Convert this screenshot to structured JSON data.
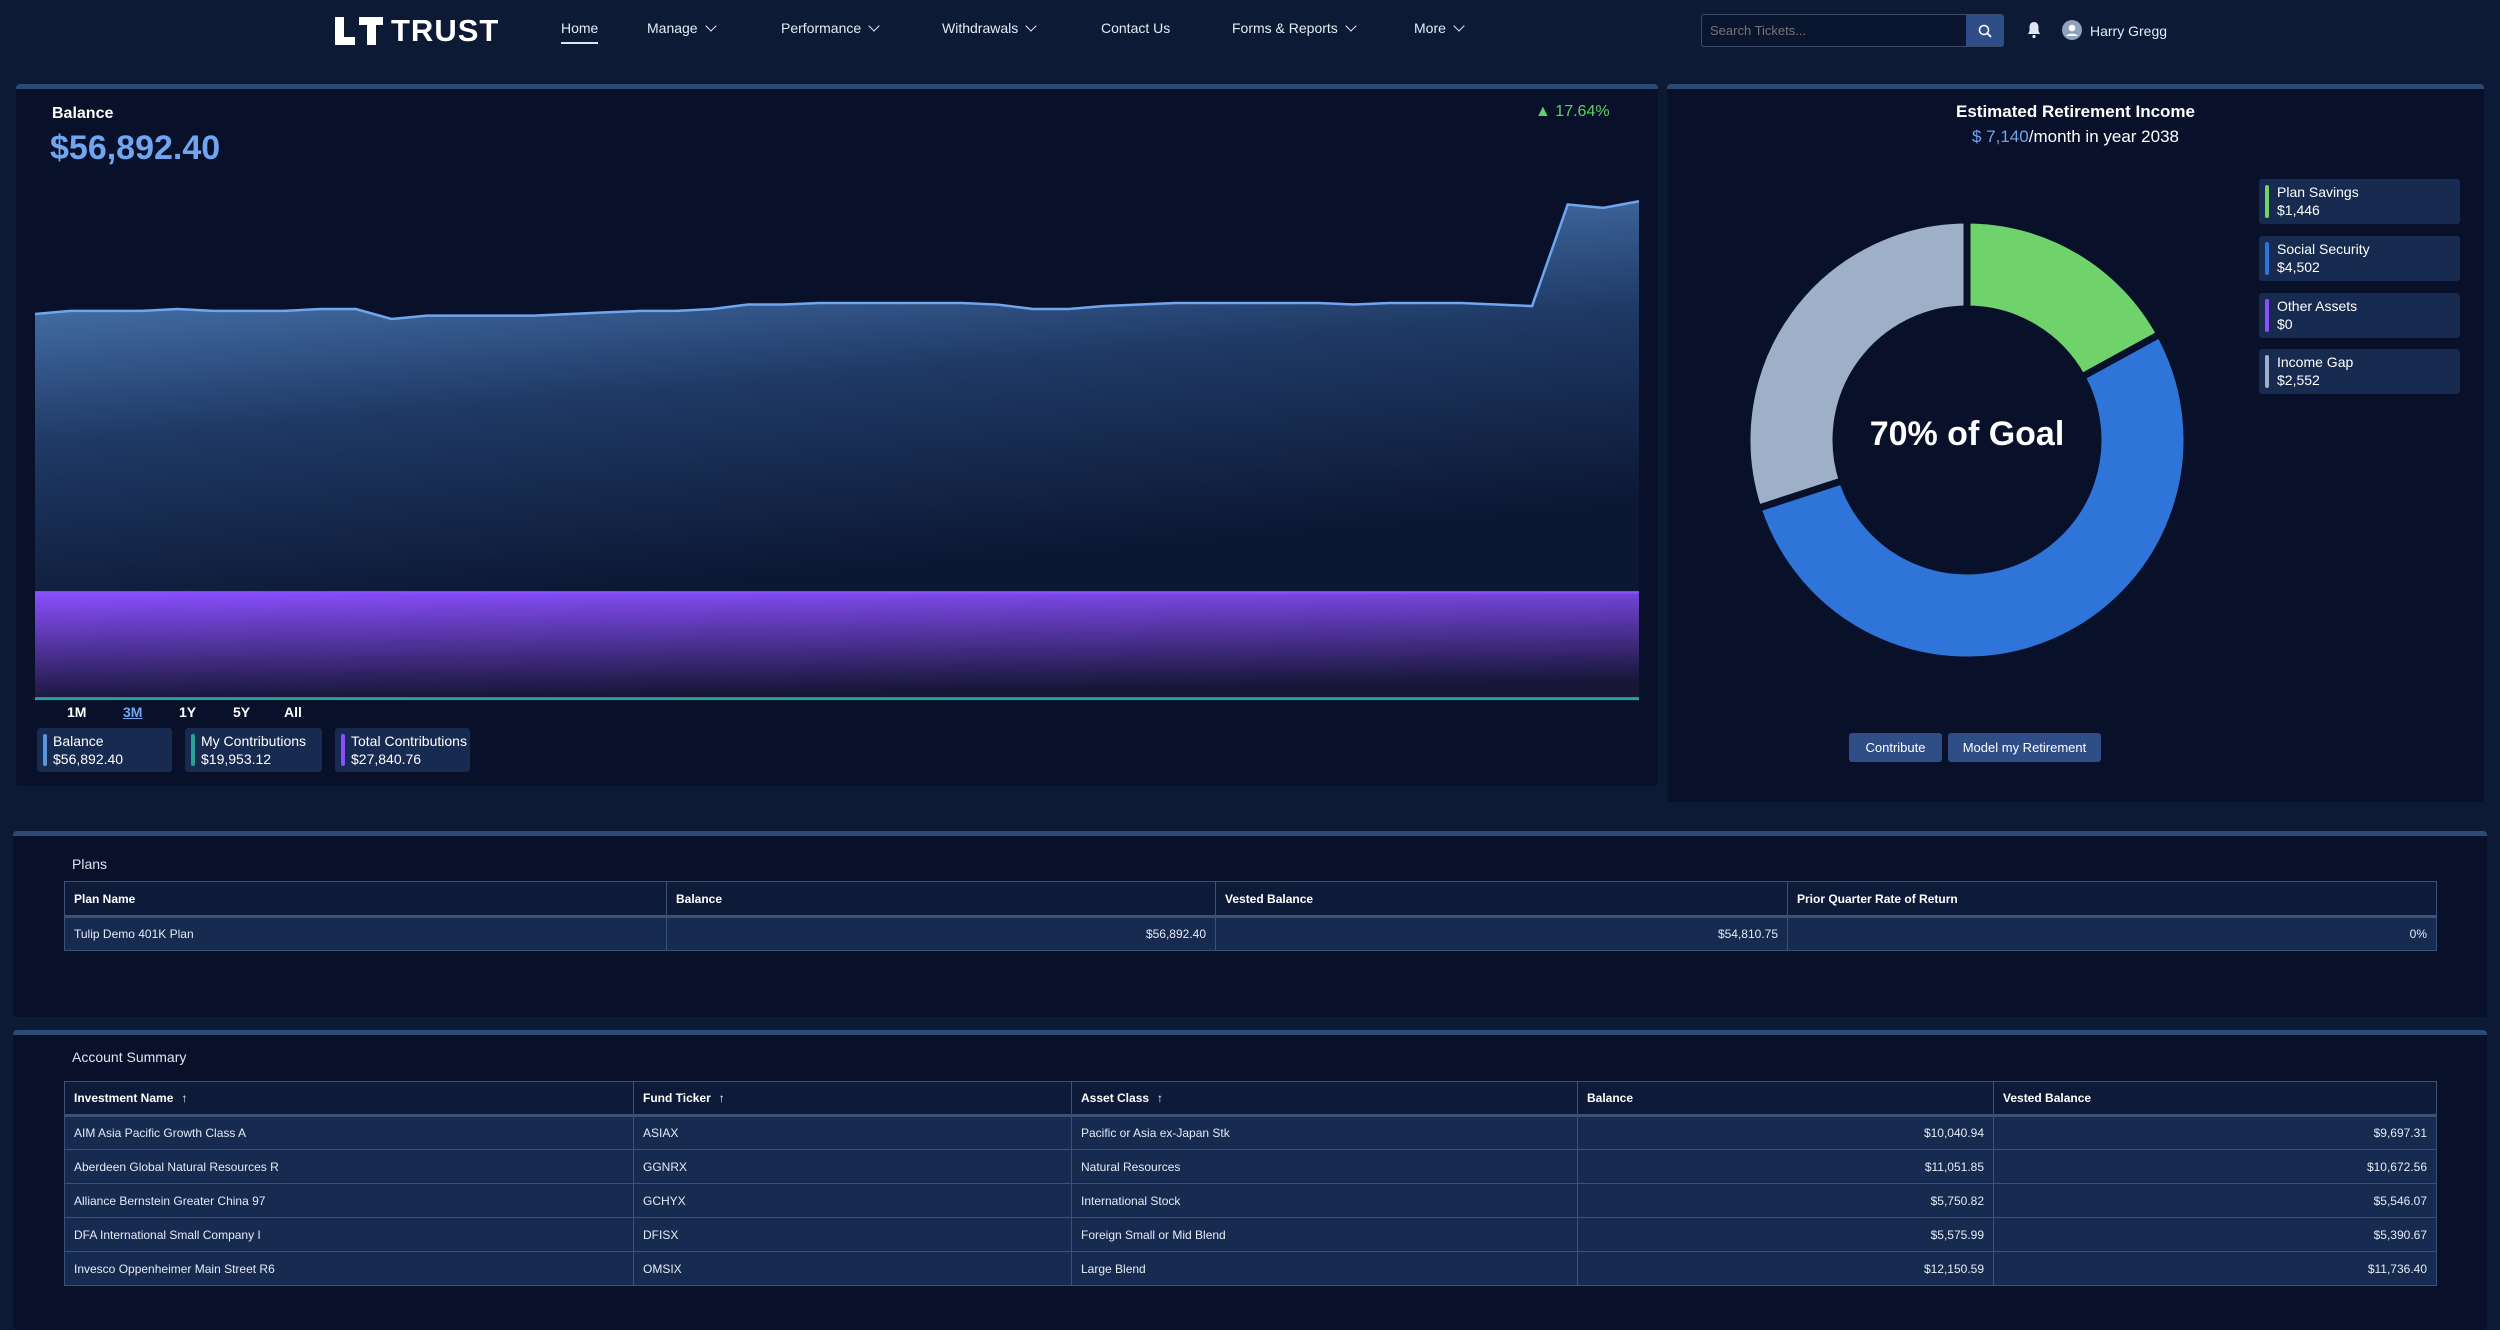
{
  "header": {
    "logo": "LT TRUST",
    "nav": [
      {
        "label": "Home",
        "active": true
      },
      {
        "label": "Manage",
        "dropdown": true
      },
      {
        "label": "Performance",
        "dropdown": true
      },
      {
        "label": "Withdrawals",
        "dropdown": true
      },
      {
        "label": "Contact Us"
      },
      {
        "label": "Forms & Reports",
        "dropdown": true
      },
      {
        "label": "More",
        "dropdown": true
      }
    ],
    "search_placeholder": "Search Tickets...",
    "user_name": "Harry Gregg"
  },
  "balance": {
    "title": "Balance",
    "value": "$56,892.40",
    "change": "17.64%",
    "change_color": "#5fd068",
    "timeframes": [
      "1M",
      "3M",
      "1Y",
      "5Y",
      "All"
    ],
    "active_timeframe": "3M",
    "legend": [
      {
        "label": "Balance",
        "value": "$56,892.40",
        "color": "#5b93dc"
      },
      {
        "label": "My Contributions",
        "value": "$19,953.12",
        "color": "#2aa198"
      },
      {
        "label": "Total Contributions",
        "value": "$27,840.76",
        "color": "#8a4fff"
      }
    ]
  },
  "chart_data": [
    {
      "type": "area",
      "ylim": [
        19850,
        58100
      ],
      "grid": false,
      "series": [
        {
          "name": "Balance",
          "values": [
            48520,
            48750,
            48750,
            48750,
            48890,
            48750,
            48750,
            48750,
            48890,
            48890,
            48150,
            48400,
            48400,
            48400,
            48400,
            48520,
            48640,
            48750,
            48750,
            48890,
            49220,
            49220,
            49340,
            49340,
            49340,
            49340,
            49340,
            49220,
            48890,
            48890,
            49110,
            49220,
            49340,
            49340,
            49340,
            49340,
            49340,
            49220,
            49340,
            49340,
            49340,
            49220,
            49110,
            56650,
            56400,
            56892
          ]
        },
        {
          "name": "Total Contributions",
          "values": [
            27840,
            27840
          ]
        },
        {
          "name": "My Contributions",
          "values": [
            19953,
            19953
          ]
        }
      ]
    },
    {
      "type": "pie",
      "donut": true,
      "center_label": "70% of Goal",
      "slices": [
        {
          "name": "Plan Savings",
          "value": 1446,
          "color": "#6fd26b"
        },
        {
          "name": "Social Security",
          "value": 4502,
          "color": "#2f74d8"
        },
        {
          "name": "Other Assets",
          "value": 0,
          "color": "#8a4fff"
        },
        {
          "name": "Income Gap",
          "value": 2552,
          "color": "#9db0c8"
        }
      ]
    }
  ],
  "retirement": {
    "title": "Estimated Retirement Income",
    "amount": "$ 7,140",
    "suffix": "/month in year 2038",
    "center": "70% of Goal",
    "legend": [
      {
        "label": "Plan Savings",
        "value": "$1,446",
        "color": "#6fd26b"
      },
      {
        "label": "Social Security",
        "value": "$4,502",
        "color": "#2f74d8"
      },
      {
        "label": "Other Assets",
        "value": "$0",
        "color": "#8a4fff"
      },
      {
        "label": "Income Gap",
        "value": "$2,552",
        "color": "#9db0c8"
      }
    ],
    "buttons": [
      "Contribute",
      "Model my Retirement"
    ]
  },
  "plans": {
    "title": "Plans",
    "columns": [
      "Plan Name",
      "Balance",
      "Vested Balance",
      "Prior Quarter Rate of Return"
    ],
    "rows": [
      [
        "Tulip Demo 401K Plan",
        "$56,892.40",
        "$54,810.75",
        "0%"
      ]
    ]
  },
  "account": {
    "title": "Account Summary",
    "columns": [
      "Investment Name",
      "Fund Ticker",
      "Asset Class",
      "Balance",
      "Vested Balance"
    ],
    "sortable": [
      true,
      true,
      true,
      false,
      false
    ],
    "rows": [
      [
        "AIM Asia Pacific Growth Class A",
        "ASIAX",
        "Pacific or Asia ex-Japan Stk",
        "$10,040.94",
        "$9,697.31"
      ],
      [
        "Aberdeen Global Natural Resources R",
        "GGNRX",
        "Natural Resources",
        "$11,051.85",
        "$10,672.56"
      ],
      [
        "Alliance Bernstein Greater China 97",
        "GCHYX",
        "International Stock",
        "$5,750.82",
        "$5,546.07"
      ],
      [
        "DFA International Small Company I",
        "DFISX",
        "Foreign Small or Mid Blend",
        "$5,575.99",
        "$5,390.67"
      ],
      [
        "Invesco Oppenheimer Main Street R6",
        "OMSIX",
        "Large Blend",
        "$12,150.59",
        "$11,736.40"
      ]
    ]
  }
}
